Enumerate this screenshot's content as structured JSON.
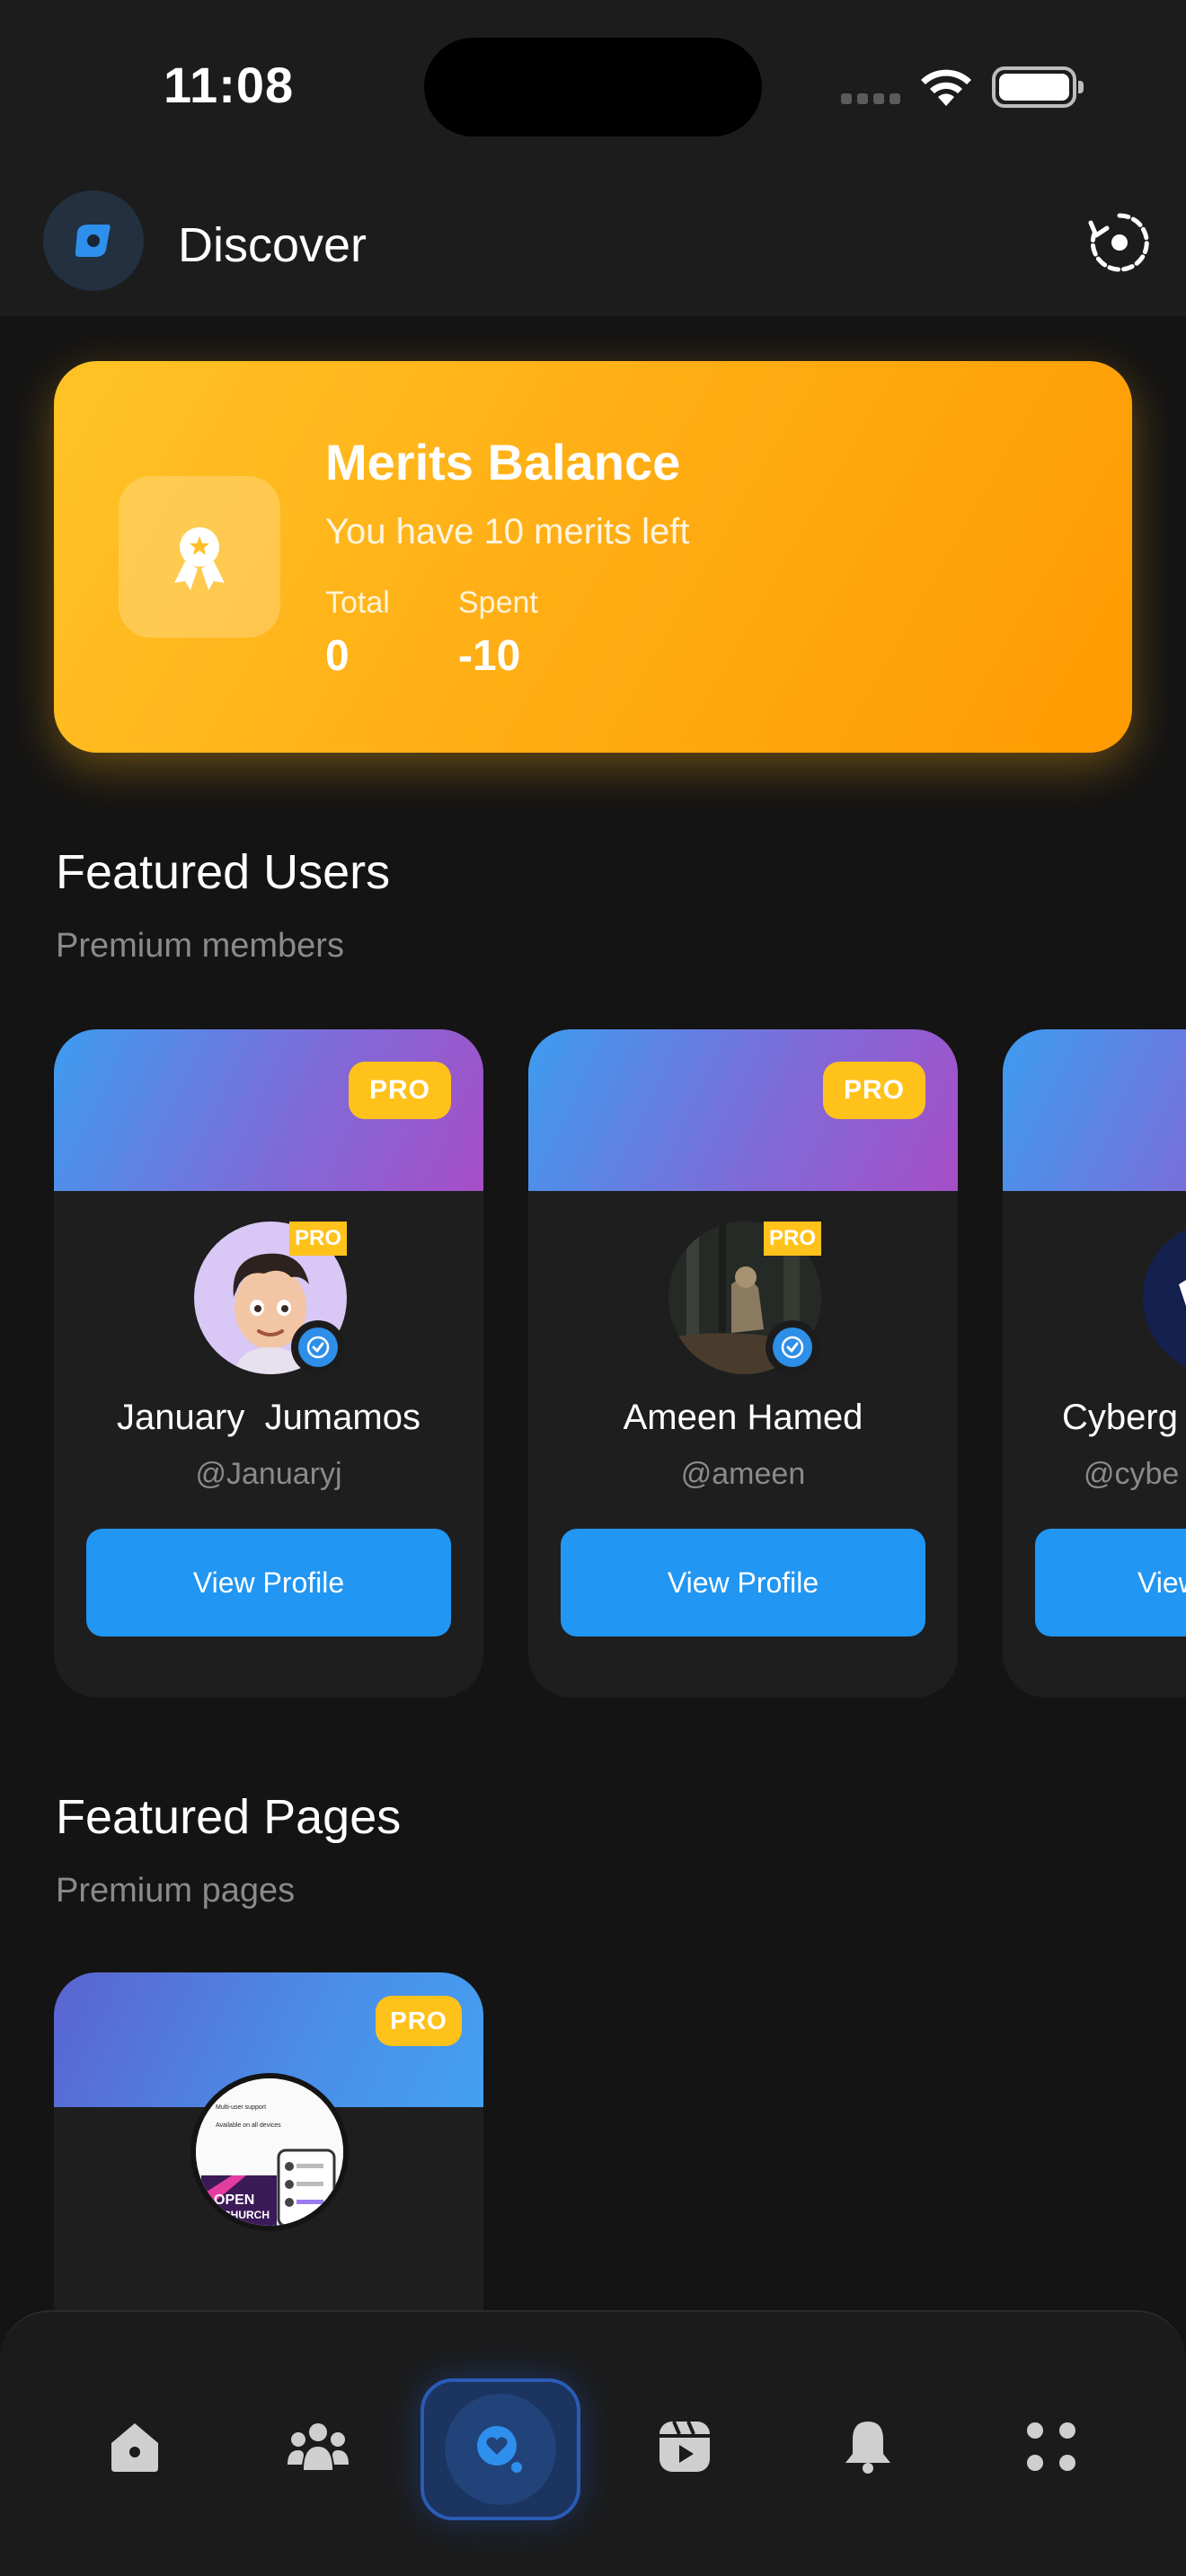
{
  "status_bar": {
    "time": "11:08"
  },
  "header": {
    "title": "Discover",
    "logo_icon": "compass-icon",
    "refresh_icon": "refresh-icon"
  },
  "merits": {
    "title": "Merits Balance",
    "subtitle": "You have 10 merits left",
    "stats": [
      {
        "label": "Total",
        "value": "0"
      },
      {
        "label": "Spent",
        "value": "-10"
      }
    ],
    "colors": {
      "gradient_start": "#ffc326",
      "gradient_end": "#ff9a02"
    }
  },
  "featured_users": {
    "title": "Featured Users",
    "subtitle": "Premium members",
    "badge": "PRO",
    "mini_badge": "PRO",
    "users": [
      {
        "name": "January  Jumamos",
        "handle": "@Januaryj",
        "button": "View Profile"
      },
      {
        "name": "Ameen Hamed",
        "handle": "@ameen",
        "button": "View Profile"
      },
      {
        "name": "Cyberg",
        "handle": "@cybe",
        "button": "View"
      }
    ]
  },
  "featured_pages": {
    "title": "Featured Pages",
    "subtitle": "Premium pages",
    "badge": "PRO",
    "page_preview_text": [
      "Multi-user support",
      "Available on all devices",
      "OPEN",
      "CHURCH"
    ]
  },
  "bottom_nav": {
    "items": [
      "home-icon",
      "groups-icon",
      "discover-icon",
      "reels-icon",
      "notifications-icon",
      "menu-icon"
    ],
    "active_index": 2,
    "accent": "#2a5bb6"
  }
}
